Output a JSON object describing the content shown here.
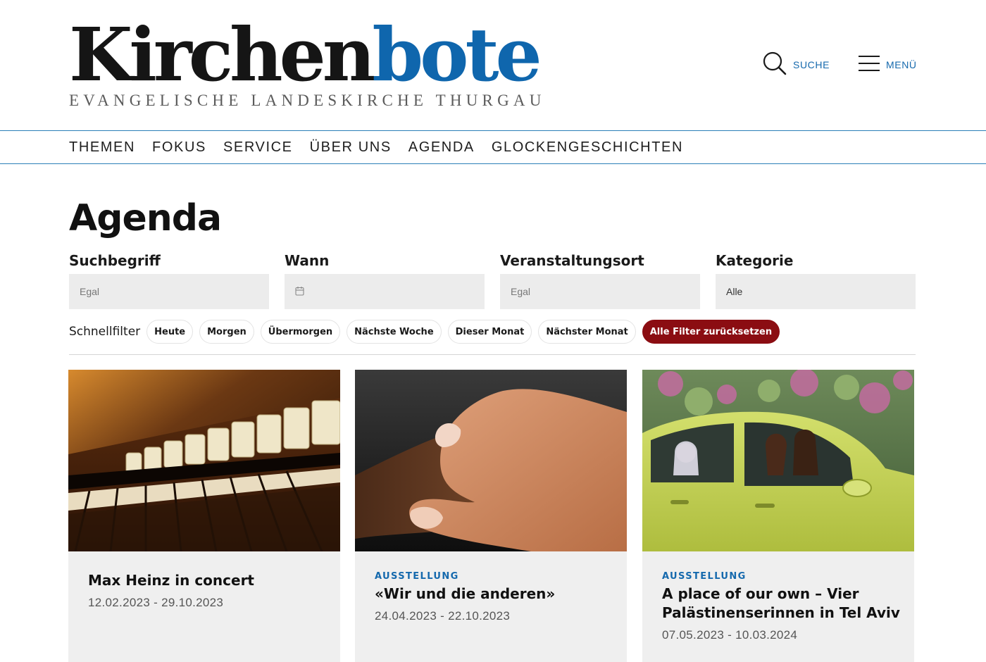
{
  "site": {
    "logo_part1": "Kirchen",
    "logo_part2": "bote",
    "logo_sub": "EVANGELISCHE LANDESKIRCHE THURGAU",
    "search_label": "SUCHE",
    "menu_label": "MENÜ",
    "brand_blue": "#0f66ad",
    "accent_red": "#8b0d12"
  },
  "nav": {
    "items": [
      {
        "label": "THEMEN"
      },
      {
        "label": "FOKUS"
      },
      {
        "label": "SERVICE"
      },
      {
        "label": "ÜBER UNS"
      },
      {
        "label": "AGENDA"
      },
      {
        "label": "GLOCKENGESCHICHTEN"
      }
    ]
  },
  "page": {
    "title": "Agenda"
  },
  "filters": {
    "search": {
      "label": "Suchbegriff",
      "placeholder": "Egal"
    },
    "when": {
      "label": "Wann",
      "icon": "calendar-icon"
    },
    "location": {
      "label": "Veranstaltungsort",
      "placeholder": "Egal"
    },
    "category": {
      "label": "Kategorie",
      "value": "Alle"
    }
  },
  "quickfilter": {
    "label": "Schnellfilter",
    "chips": [
      {
        "label": "Heute"
      },
      {
        "label": "Morgen"
      },
      {
        "label": "Übermorgen"
      },
      {
        "label": "Nächste Woche"
      },
      {
        "label": "Dieser Monat"
      },
      {
        "label": "Nächster Monat"
      }
    ],
    "reset_label": "Alle Filter zurücksetzen"
  },
  "cards": [
    {
      "image": "organ-stops-image",
      "category": "",
      "title": "Max Heinz in concert",
      "dates": "12.02.2023 - 29.10.2023"
    },
    {
      "image": "handshake-image",
      "category": "AUSSTELLUNG",
      "title": "«Wir und die anderen»",
      "dates": "24.04.2023 - 22.10.2023"
    },
    {
      "image": "women-in-car-image",
      "category": "AUSSTELLUNG",
      "title": "A place of our own – Vier Palästinenserinnen in Tel Aviv",
      "dates": "07.05.2023 - 10.03.2024"
    }
  ]
}
